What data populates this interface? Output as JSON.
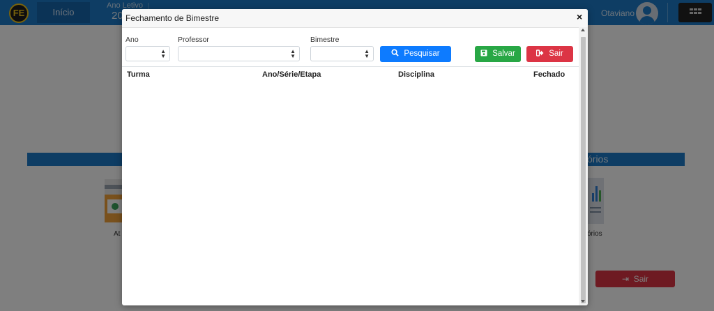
{
  "app": {
    "logo_text": "FE",
    "nav_inicio": "Início",
    "ano_letivo_label": "Ano Letivo",
    "ano_letivo_value": "20",
    "username": "Otaviano",
    "section_right_label": "órios",
    "card_left_label": "At",
    "card_right_label": "órios",
    "bg_sair_label": "Sair"
  },
  "modal": {
    "title": "Fechamento de Bimestre",
    "close_label": "×",
    "filters": {
      "ano_label": "Ano",
      "ano_value": "",
      "professor_label": "Professor",
      "professor_value": "",
      "bimestre_label": "Bimestre",
      "bimestre_value": ""
    },
    "buttons": {
      "pesquisar": "Pesquisar",
      "salvar": "Salvar",
      "sair": "Sair"
    },
    "table": {
      "columns": [
        "Turma",
        "Ano/Série/Etapa",
        "Disciplina",
        "Fechado"
      ],
      "rows": []
    }
  },
  "icons": {
    "search": "search-icon",
    "save": "save-icon",
    "exit": "sign-out-icon",
    "apps": "grid-icon",
    "user": "user-avatar-icon"
  },
  "colors": {
    "primary": "#1c7ac8",
    "pesquisar": "#0d7bff",
    "salvar": "#28a745",
    "sair": "#dc3545"
  }
}
